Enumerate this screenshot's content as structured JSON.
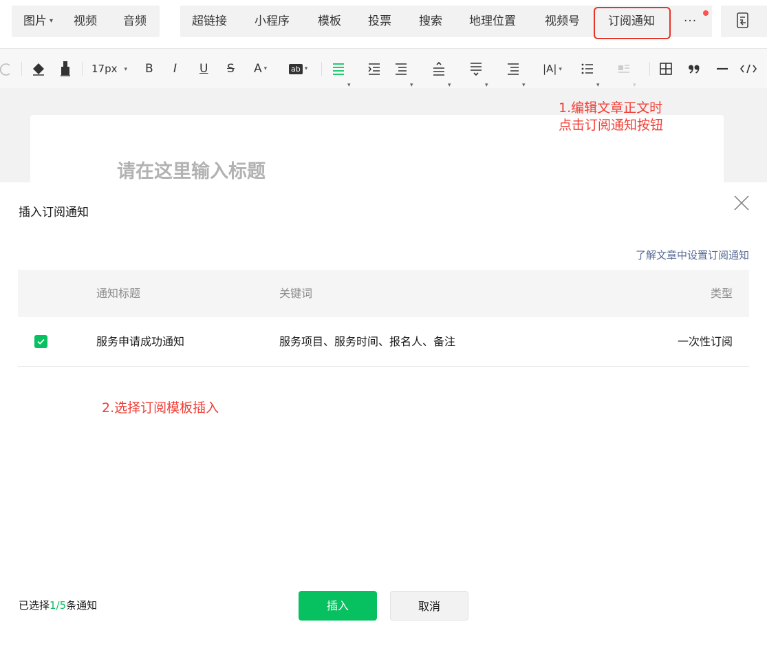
{
  "menu": {
    "image": "图片",
    "video": "视频",
    "audio": "音频",
    "hyperlink": "超链接",
    "mini_program": "小程序",
    "template": "模板",
    "vote": "投票",
    "search": "搜索",
    "location": "地理位置",
    "channels": "视频号",
    "subscribe_notice": "订阅通知",
    "more": "···"
  },
  "toolbar": {
    "font_size": "17px",
    "bold": "B",
    "italic": "I",
    "underline": "U",
    "strike": "S",
    "font_color": "A",
    "bg_color": "ab",
    "letter_spacing": "|A|"
  },
  "editor": {
    "title_placeholder": "请在这里输入标题"
  },
  "annotations": {
    "step1_line1": "1.编辑文章正文时",
    "step1_line2": "点击订阅通知按钮",
    "step2": "2.选择订阅模板插入"
  },
  "dialog": {
    "title": "插入订阅通知",
    "help_link": "了解文章中设置订阅通知",
    "columns": {
      "title": "通知标题",
      "keywords": "关键词",
      "type": "类型"
    },
    "rows": [
      {
        "title": "服务申请成功通知",
        "keywords": "服务项目、服务时间、报名人、备注",
        "type": "一次性订阅",
        "checked": true
      }
    ],
    "selection": {
      "prefix": "已选择",
      "count": "1/5",
      "suffix": "条通知"
    },
    "insert_label": "插入",
    "cancel_label": "取消"
  },
  "colors": {
    "accent_green": "#07c160",
    "annotation_red": "#f13e36",
    "link_blue": "#576b95",
    "badge_red": "#fa5151"
  }
}
